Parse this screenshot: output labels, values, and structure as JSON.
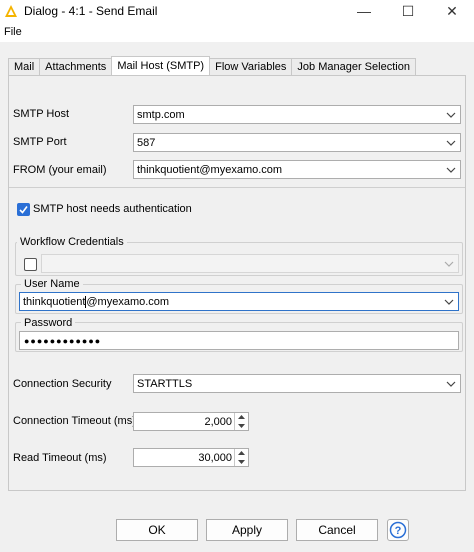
{
  "window": {
    "title": "Dialog - 4:1 - Send Email",
    "minimize_glyph": "—",
    "maximize_glyph": "☐",
    "close_glyph": "✕"
  },
  "menu": {
    "file": "File"
  },
  "tabs": [
    {
      "label": "Mail",
      "active": false
    },
    {
      "label": "Attachments",
      "active": false
    },
    {
      "label": "Mail Host (SMTP)",
      "active": true
    },
    {
      "label": "Flow Variables",
      "active": false
    },
    {
      "label": "Job Manager Selection",
      "active": false
    }
  ],
  "smtp": {
    "host_label": "SMTP Host",
    "host_value": "smtp.com",
    "port_label": "SMTP Port",
    "port_value": "587",
    "from_label": "FROM (your email)",
    "from_value": "thinkquotient@myexamo.com",
    "auth_label": "SMTP host needs authentication",
    "auth_checked": true
  },
  "credentials": {
    "group_label": "Workflow Credentials",
    "enabled": false,
    "user_group_label": "User Name",
    "user_value_before_caret": "thinkquotient",
    "user_value_after_caret": "@myexamo.com",
    "password_group_label": "Password",
    "password_masked": "●●●●●●●●●●●●"
  },
  "connection": {
    "security_label": "Connection Security",
    "security_value": "STARTTLS",
    "timeout_label": "Connection Timeout (ms)",
    "timeout_value": "2,000",
    "read_timeout_label": "Read Timeout (ms)",
    "read_timeout_value": "30,000"
  },
  "buttons": {
    "ok": "OK",
    "apply": "Apply",
    "cancel": "Cancel",
    "help": "?"
  },
  "colors": {
    "accent": "#2a6fd6",
    "focus_border": "#2f73c9",
    "app_icon": "#f5b400"
  },
  "icons": {
    "app": "knime-warning-triangle-icon",
    "dropdown": "chevron-down-icon",
    "spin_up": "spin-up-icon",
    "spin_down": "spin-down-icon",
    "help": "help-icon"
  }
}
